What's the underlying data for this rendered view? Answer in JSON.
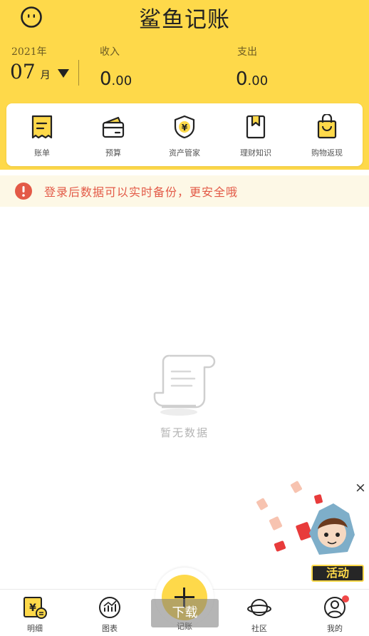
{
  "app": {
    "title": "鲨鱼记账"
  },
  "header": {
    "year": "2021年",
    "month": "07",
    "month_unit": "月",
    "income": {
      "label": "收入",
      "int": "0",
      "dec": ".00"
    },
    "expense": {
      "label": "支出",
      "int": "0",
      "dec": ".00"
    }
  },
  "toolbar": {
    "items": [
      {
        "label": "账单",
        "icon": "bill-icon"
      },
      {
        "label": "预算",
        "icon": "wallet-icon"
      },
      {
        "label": "资产管家",
        "icon": "shield-yen-icon"
      },
      {
        "label": "理财知识",
        "icon": "bookmark-icon"
      },
      {
        "label": "购物返现",
        "icon": "shopping-bag-icon"
      }
    ]
  },
  "banner": {
    "text": "登录后数据可以实时备份，更安全哦",
    "icon": "alert-icon"
  },
  "empty": {
    "text": "暂无数据"
  },
  "promo": {
    "badge": "活动",
    "close": "×"
  },
  "tabs": [
    {
      "label": "明细",
      "icon": "detail-icon"
    },
    {
      "label": "图表",
      "icon": "chart-icon"
    },
    {
      "label": "记账",
      "icon": "plus-icon"
    },
    {
      "label": "社区",
      "icon": "planet-icon"
    },
    {
      "label": "我的",
      "icon": "profile-icon"
    }
  ],
  "overlay": {
    "download": "下载"
  },
  "colors": {
    "brand": "#fed94a",
    "alert": "#e35a47",
    "dot": "#f04848"
  }
}
